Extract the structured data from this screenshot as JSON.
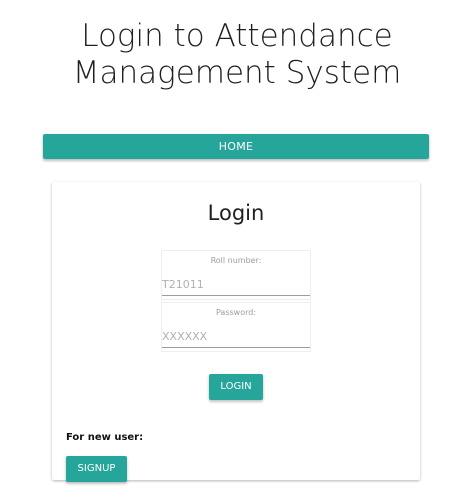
{
  "header": {
    "title_line1": "Login to Attendance",
    "title_line2": "Management System"
  },
  "nav": {
    "home_label": "HOME"
  },
  "login_card": {
    "title": "Login",
    "roll_number": {
      "label": "Roll number:",
      "placeholder": "T21011",
      "value": ""
    },
    "password": {
      "label": "Password:",
      "placeholder": "XXXXXX",
      "value": ""
    },
    "login_button_label": "LOGIN",
    "new_user_text": "For new user:",
    "signup_button_label": "SIGNUP"
  },
  "colors": {
    "accent": "#26a69a",
    "background": "#ffffff",
    "text": "#212121",
    "muted_text": "#9e9e9e"
  }
}
